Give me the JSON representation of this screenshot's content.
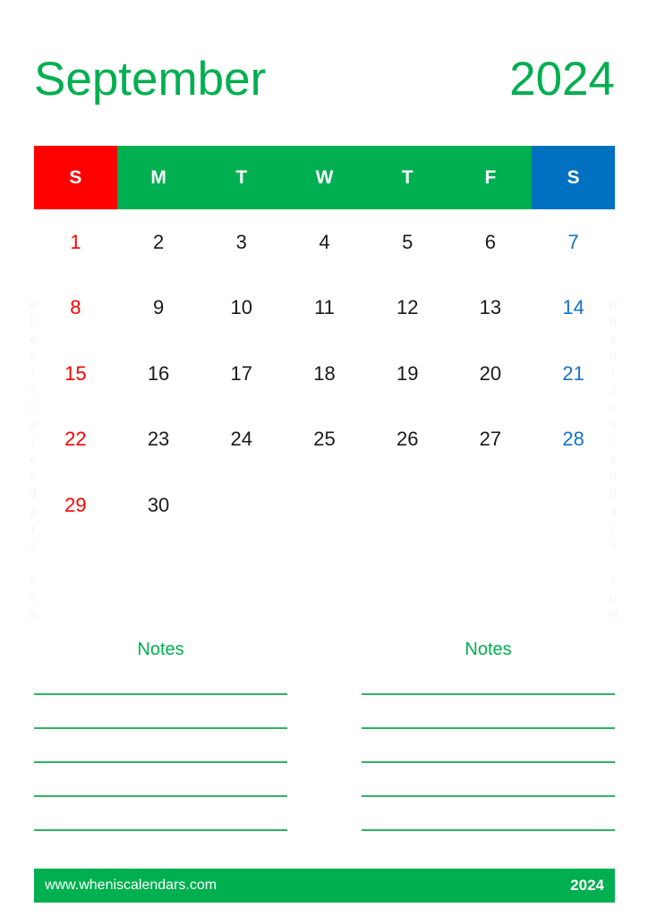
{
  "header": {
    "month": "September",
    "year": "2024"
  },
  "weekdays": [
    {
      "label": "S",
      "kind": "sun"
    },
    {
      "label": "M",
      "kind": "weekday"
    },
    {
      "label": "T",
      "kind": "weekday"
    },
    {
      "label": "W",
      "kind": "weekday"
    },
    {
      "label": "T",
      "kind": "weekday"
    },
    {
      "label": "F",
      "kind": "weekday"
    },
    {
      "label": "S",
      "kind": "sat"
    }
  ],
  "weeks": [
    [
      {
        "label": "1",
        "kind": "sun"
      },
      {
        "label": "2",
        "kind": "weekday"
      },
      {
        "label": "3",
        "kind": "weekday"
      },
      {
        "label": "4",
        "kind": "weekday"
      },
      {
        "label": "5",
        "kind": "weekday"
      },
      {
        "label": "6",
        "kind": "weekday"
      },
      {
        "label": "7",
        "kind": "sat"
      }
    ],
    [
      {
        "label": "8",
        "kind": "sun"
      },
      {
        "label": "9",
        "kind": "weekday"
      },
      {
        "label": "10",
        "kind": "weekday"
      },
      {
        "label": "11",
        "kind": "weekday"
      },
      {
        "label": "12",
        "kind": "weekday"
      },
      {
        "label": "13",
        "kind": "weekday"
      },
      {
        "label": "14",
        "kind": "sat"
      }
    ],
    [
      {
        "label": "15",
        "kind": "sun"
      },
      {
        "label": "16",
        "kind": "weekday"
      },
      {
        "label": "17",
        "kind": "weekday"
      },
      {
        "label": "18",
        "kind": "weekday"
      },
      {
        "label": "19",
        "kind": "weekday"
      },
      {
        "label": "20",
        "kind": "weekday"
      },
      {
        "label": "21",
        "kind": "sat"
      }
    ],
    [
      {
        "label": "22",
        "kind": "sun"
      },
      {
        "label": "23",
        "kind": "weekday"
      },
      {
        "label": "24",
        "kind": "weekday"
      },
      {
        "label": "25",
        "kind": "weekday"
      },
      {
        "label": "26",
        "kind": "weekday"
      },
      {
        "label": "27",
        "kind": "weekday"
      },
      {
        "label": "28",
        "kind": "sat"
      }
    ],
    [
      {
        "label": "29",
        "kind": "sun"
      },
      {
        "label": "30",
        "kind": "weekday"
      },
      {
        "label": "",
        "kind": "empty"
      },
      {
        "label": "",
        "kind": "empty"
      },
      {
        "label": "",
        "kind": "empty"
      },
      {
        "label": "",
        "kind": "empty"
      },
      {
        "label": "",
        "kind": "empty"
      }
    ]
  ],
  "notes": {
    "left_title": "Notes",
    "right_title": "Notes",
    "line_count": 5
  },
  "watermark": {
    "text": "wheniscalendars.com"
  },
  "footer": {
    "url": "www.wheniscalendars.com",
    "year": "2024"
  },
  "colors": {
    "green": "#00AF50",
    "red": "#FF0000",
    "blue": "#0070C0",
    "saturday_text": "#1373C6",
    "note_line": "#2CB464",
    "weekday_text": "#1a1a1a",
    "watermark": "#f4f4f4"
  }
}
